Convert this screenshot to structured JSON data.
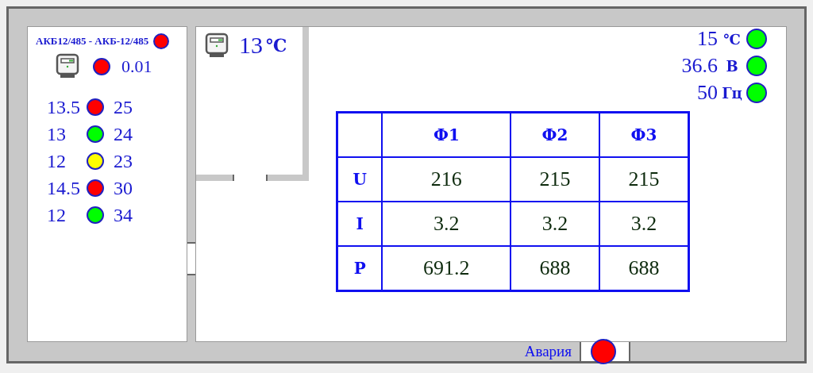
{
  "battery_room": {
    "title": "АКБ12/485 - АКБ-12/485",
    "title_status": {
      "color": "#ff0000"
    },
    "meter": {
      "status": {
        "color": "#ff0000"
      },
      "value": "0.01"
    },
    "batteries": [
      {
        "voltage": "13.5",
        "color": "#ff0000",
        "temperature": "25"
      },
      {
        "voltage": "13",
        "color": "#00ff00",
        "temperature": "24"
      },
      {
        "voltage": "12",
        "color": "#ffff00",
        "temperature": "23"
      },
      {
        "voltage": "14.5",
        "color": "#ff0000",
        "temperature": "30"
      },
      {
        "voltage": "12",
        "color": "#00ff00",
        "temperature": "34"
      }
    ]
  },
  "small_room": {
    "temperature": "13",
    "unit": "℃"
  },
  "sensors": [
    {
      "value": "15",
      "unit": "℃",
      "color": "#00ff00"
    },
    {
      "value": "36.6",
      "unit": "В",
      "color": "#00ff00"
    },
    {
      "value": "50",
      "unit": "Гц",
      "color": "#00ff00"
    }
  ],
  "phase_table": {
    "columns": [
      "Ф1",
      "Ф2",
      "Ф3"
    ],
    "rows": [
      {
        "label": "U",
        "cells": [
          "216",
          "215",
          "215"
        ]
      },
      {
        "label": "I",
        "cells": [
          "3.2",
          "3.2",
          "3.2"
        ]
      },
      {
        "label": "P",
        "cells": [
          "691.2",
          "688",
          "688"
        ]
      }
    ]
  },
  "alarm": {
    "label": "Авария",
    "color": "#ff0000"
  }
}
